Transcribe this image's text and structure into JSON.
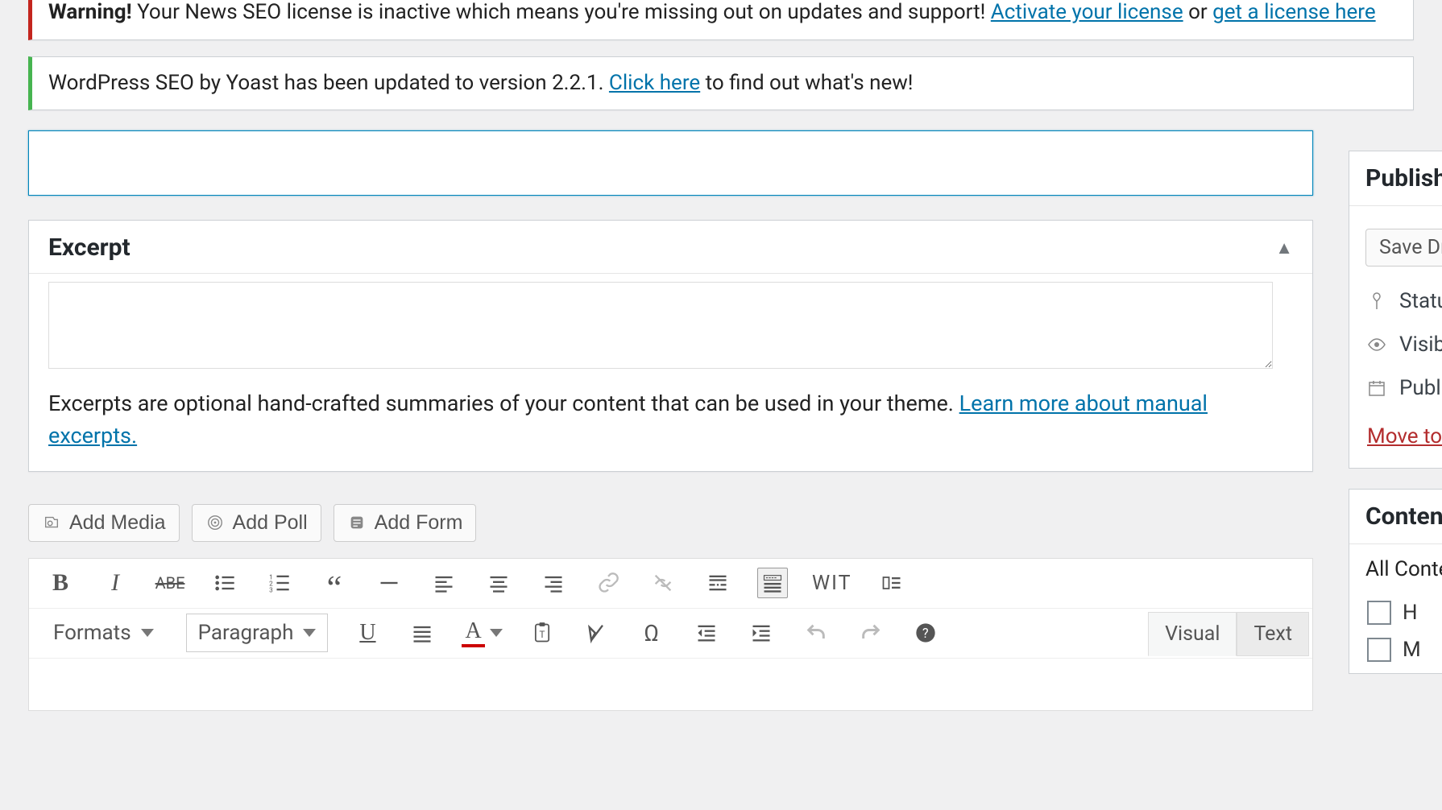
{
  "notices": {
    "warning": {
      "prefix": "Warning!",
      "text_before": " Your News SEO license is inactive which means you're missing out on updates and support! ",
      "link1": "Activate your license",
      "middle": " or ",
      "link2": "get a license here"
    },
    "update": {
      "text_before": "WordPress SEO by Yoast has been updated to version 2.2.1. ",
      "link": "Click here",
      "text_after": " to find out what's new!"
    }
  },
  "title": {
    "value": ""
  },
  "excerpt": {
    "heading": "Excerpt",
    "value": "",
    "help_before": "Excerpts are optional hand-crafted summaries of your content that can be used in your theme. ",
    "help_link": "Learn more about manual excerpts."
  },
  "media_buttons": {
    "add_media": "Add Media",
    "add_poll": "Add Poll",
    "add_form": "Add Form"
  },
  "editor": {
    "tabs": {
      "visual": "Visual",
      "text": "Text"
    },
    "formats_label": "Formats",
    "paragraph_label": "Paragraph",
    "wit_label": "WIT"
  },
  "publish": {
    "heading": "Publish",
    "save_draft": "Save Draft",
    "status_label": "Status",
    "visibility_label": "Visibility",
    "publish_label": "Publish",
    "trash": "Move to Trash"
  },
  "content_box": {
    "heading": "Content",
    "all_content": "All Content",
    "opt_h": "H",
    "opt_m": "M"
  }
}
